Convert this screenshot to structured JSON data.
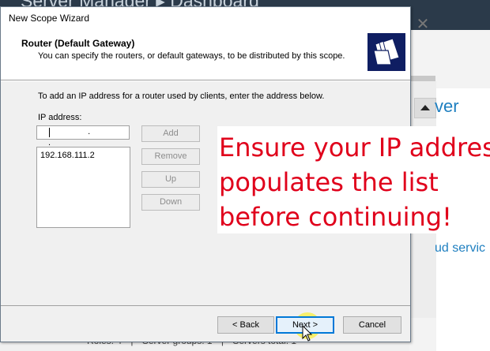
{
  "background": {
    "title": "Server Manager ▸ Dashboard",
    "server_text": "ver",
    "cloud_text": "ud servic",
    "status": {
      "roles": "Roles: 4",
      "server_groups": "Server groups: 1",
      "servers_total": "Servers total: 1"
    }
  },
  "dialog": {
    "title": "New Scope Wizard",
    "header": {
      "title": "Router (Default Gateway)",
      "subtitle": "You can specify the routers, or default gateways, to be distributed by this scope."
    },
    "instruction": "To add an IP address for a router used by clients, enter the address below.",
    "ip_label": "IP address:",
    "ip_value": ". . .",
    "router_list": [
      "192.168.111.2"
    ],
    "buttons": {
      "add": "Add",
      "remove": "Remove",
      "up": "Up",
      "down": "Down",
      "back": "< Back",
      "next": "Next >",
      "cancel": "Cancel"
    }
  },
  "annotation": {
    "line1": "Ensure your IP address",
    "line2": "populates the list",
    "line3": "before continuing!",
    "color": "#e0001b"
  }
}
